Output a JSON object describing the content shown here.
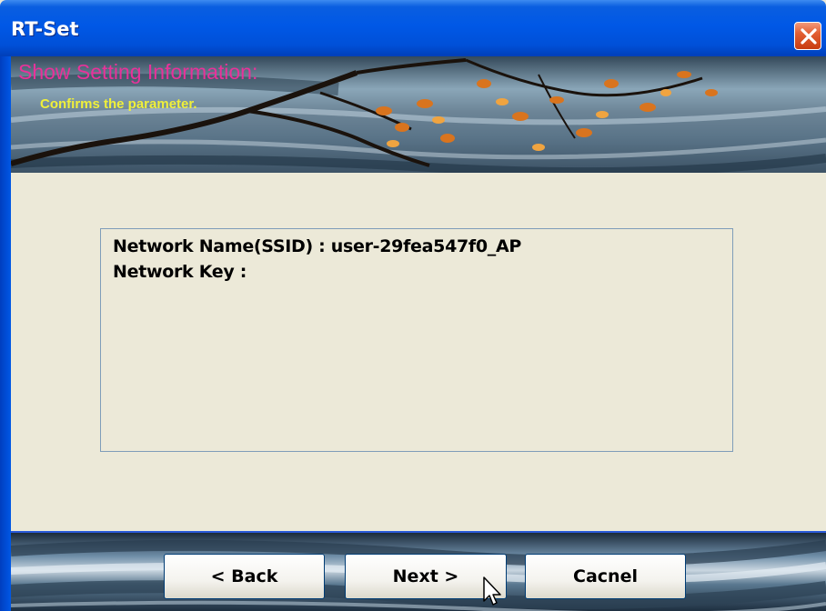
{
  "window": {
    "title": "RT-Set",
    "title_color": "#0058e6"
  },
  "banner": {
    "heading": "Show Setting Information:",
    "heading_color": "#e8329a",
    "subheading": "Confirms the parameter.",
    "subheading_color": "#f0f03a"
  },
  "info": {
    "ssid_line": "Network Name(SSID) : user-29fea547f0_AP",
    "key_line": "Network Key :"
  },
  "buttons": {
    "back": "< Back",
    "next": "Next >",
    "cancel": "Cacnel"
  },
  "icons": {
    "close": "close-icon",
    "cursor": "mouse-pointer-icon"
  }
}
